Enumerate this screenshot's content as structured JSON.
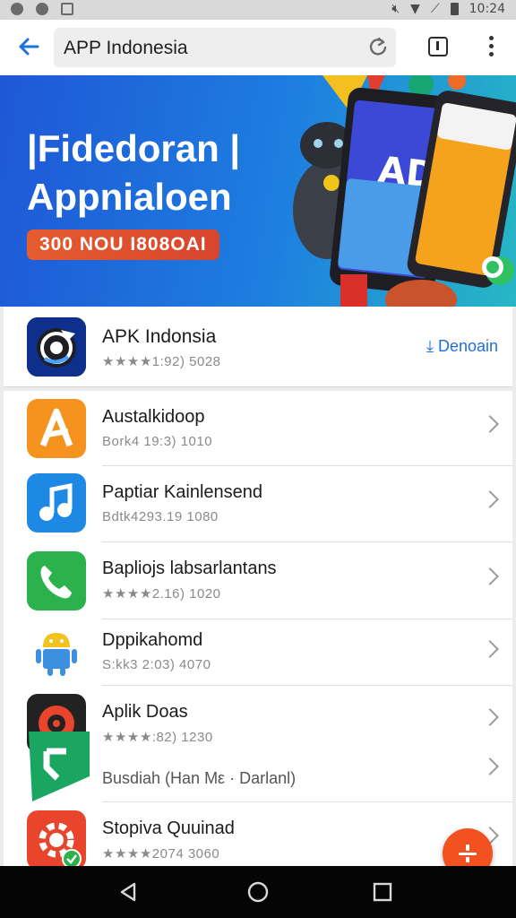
{
  "status_bar": {
    "time": "10:24",
    "icons": [
      "shield-icon",
      "messenger-icon",
      "photo-icon",
      "mute-icon",
      "wifi-icon",
      "signal-icon",
      "battery-icon"
    ]
  },
  "address_bar": {
    "url_text": "APP Indonesia",
    "icons": [
      "back-arrow-icon",
      "reload-icon",
      "tabs-icon",
      "more-vert-icon"
    ]
  },
  "banner": {
    "title_line1": "|Fidedoran |",
    "title_line2": "Appnialoen",
    "badge": "300 NOU I808OAI"
  },
  "featured_app": {
    "name": "APK Indonsia",
    "meta": "★★★★1:92)  5028",
    "download_label": "⤓ Denoain",
    "icon": "apk-logo-icon"
  },
  "apps": [
    {
      "name": "Austalkidoop",
      "meta": "Bork4 19:3)  1010",
      "icon": "letter-a-app-icon",
      "color": "#f6931e"
    },
    {
      "name": "Paptiar Kainlensend",
      "meta": "Bdtk4293.19  1080",
      "icon": "music-note-app-icon",
      "color": "#1e88e5"
    },
    {
      "name": "Bapliojs labsarlantans",
      "meta": "★★★★2.16)  1020",
      "icon": "phone-app-icon",
      "color": "#2bb24c"
    },
    {
      "name": "Dppikahomd",
      "meta": "S:kk3 2:03)  4070",
      "icon": "android-robot-icon",
      "color": "#3d8fe0"
    },
    {
      "name": "Aplik Doas",
      "meta": "★★★★:82)  1230",
      "icon": "record-app-icon",
      "color": "#222222"
    },
    {
      "name": "Busdiah (Han Mε · Darlanl)",
      "meta": "",
      "icon": "green-flag-app-icon",
      "color": "#1aa661"
    },
    {
      "name": "Stopiva Quuinad",
      "meta": "★★★★2074  3060",
      "icon": "gear-app-icon",
      "color": "#e8452c"
    }
  ],
  "fab": {
    "icon": "download-divide-icon",
    "color": "#f1521f"
  },
  "nav_bar": {
    "icons": [
      "back-triangle-icon",
      "home-circle-icon",
      "recents-square-icon"
    ]
  }
}
